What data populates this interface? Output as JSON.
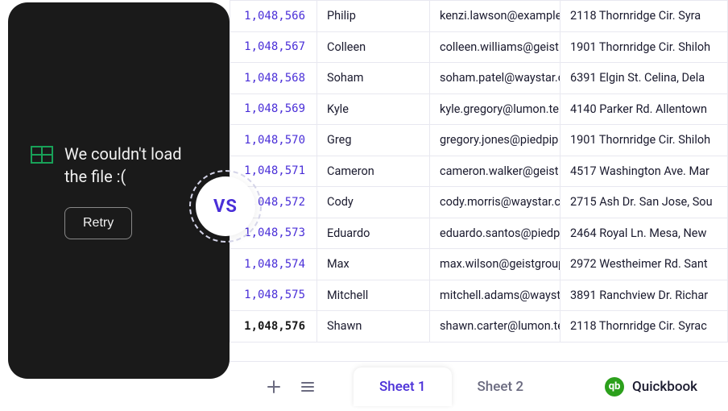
{
  "error": {
    "message": "We couldn't load the file :(",
    "retry_label": "Retry"
  },
  "vs_label": "VS",
  "rows": [
    {
      "id": "1,048,566",
      "name": "Philip",
      "email": "kenzi.lawson@example.",
      "addr": "2118 Thornridge Cir. Syra"
    },
    {
      "id": "1,048,567",
      "name": "Colleen",
      "email": "colleen.williams@geist",
      "addr": "1901 Thornridge Cir. Shiloh"
    },
    {
      "id": "1,048,568",
      "name": "Soham",
      "email": "soham.patel@waystar.c",
      "addr": "6391 Elgin St. Celina, Dela"
    },
    {
      "id": "1,048,569",
      "name": "Kyle",
      "email": "kyle.gregory@lumon.te",
      "addr": "4140 Parker Rd. Allentown"
    },
    {
      "id": "1,048,570",
      "name": "Greg",
      "email": "gregory.jones@piedpip",
      "addr": "1901 Thornridge Cir. Shiloh"
    },
    {
      "id": "1,048,571",
      "name": "Cameron",
      "email": "cameron.walker@geist",
      "addr": " 4517 Washington Ave. Mar"
    },
    {
      "id": "1,048,572",
      "name": "Cody",
      "email": "cody.morris@waystar.c",
      "addr": "2715 Ash Dr. San Jose, Sou"
    },
    {
      "id": "1,048,573",
      "name": "Eduardo",
      "email": "eduardo.santos@piedp",
      "addr": "2464 Royal Ln. Mesa, New"
    },
    {
      "id": "1,048,574",
      "name": "Max",
      "email": "max.wilson@geistgroup",
      "addr": "2972 Westheimer Rd. Sant"
    },
    {
      "id": "1,048,575",
      "name": "Mitchell",
      "email": "mitchell.adams@wayst",
      "addr": "3891 Ranchview Dr. Richar"
    },
    {
      "id": "1,048,576",
      "name": "Shawn",
      "email": "shawn.carter@lumon.te",
      "addr": "2118 Thornridge Cir. Syrac"
    }
  ],
  "tabs": {
    "sheet1": "Sheet 1",
    "sheet2": "Sheet 2",
    "connector": "Quickbook"
  }
}
